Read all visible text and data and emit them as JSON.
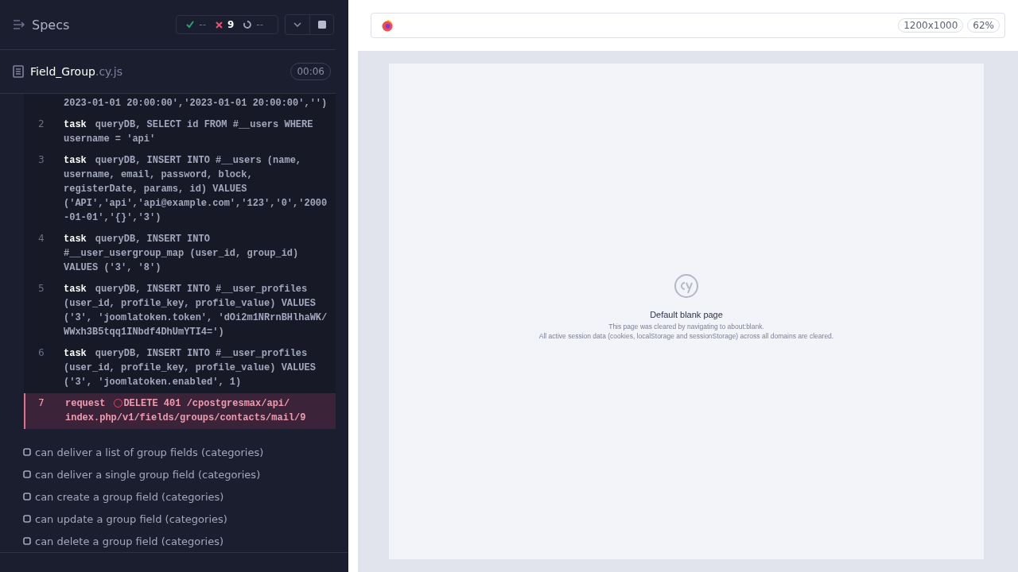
{
  "sidebar": {
    "title": "Specs",
    "stats": {
      "passed": "--",
      "failed": "9",
      "pending": "--"
    },
    "spec": {
      "name": "Field_Group",
      "extension": ".cy.js",
      "duration": "00:06"
    },
    "commands": [
      {
        "kind": "task",
        "failed": false,
        "message": "2023-01-01 20:00:00','2023-01-01 20:00:00','')"
      },
      {
        "number": "2",
        "kind": "task",
        "failed": false,
        "name": "task",
        "message": "queryDB, SELECT id FROM #__users WHERE\nusername = 'api'"
      },
      {
        "number": "3",
        "kind": "task",
        "failed": false,
        "name": "task",
        "message": "queryDB, INSERT INTO #__users (name,\nusername, email, password, block,\nregisterDate, params, id) VALUES\n('API','api','api@example.com','123','0','2000\n-01-01','{}','3')"
      },
      {
        "number": "4",
        "kind": "task",
        "failed": false,
        "name": "task",
        "message": "queryDB, INSERT INTO\n#__user_usergroup_map (user_id, group_id)\nVALUES ('3', '8')"
      },
      {
        "number": "5",
        "kind": "task",
        "failed": false,
        "name": "task",
        "message": "queryDB, INSERT INTO #__user_profiles\n(user_id, profile_key, profile_value) VALUES\n('3', 'joomlatoken.token', 'dOi2m1NRrnBHlhaWK/\nWWxh3B5tqq1INbdf4DhUmYTI4=')"
      },
      {
        "number": "6",
        "kind": "task",
        "failed": false,
        "name": "task",
        "message": "queryDB, INSERT INTO #__user_profiles\n(user_id, profile_key, profile_value) VALUES\n('3', 'joomlatoken.enabled', 1)"
      },
      {
        "number": "7",
        "kind": "request",
        "failed": true,
        "name": "request",
        "message": "DELETE 401 /cpostgresmax/api/\nindex.php/v1/fields/groups/contacts/mail/9"
      }
    ],
    "tests": [
      {
        "title": "can deliver a list of group fields (categories)"
      },
      {
        "title": "can deliver a single group field (categories)"
      },
      {
        "title": "can create a group field (categories)"
      },
      {
        "title": "can update a group field (categories)"
      },
      {
        "title": "can delete a group field (categories)"
      }
    ]
  },
  "preview": {
    "viewport_size": "1200x1000",
    "zoom": "62%",
    "blank_page": {
      "heading": "Default blank page",
      "line_1": "This page was cleared by navigating to about:blank.",
      "line_2": "All active session data (cookies, localStorage and sessionStorage) across all domains are cleared."
    }
  }
}
